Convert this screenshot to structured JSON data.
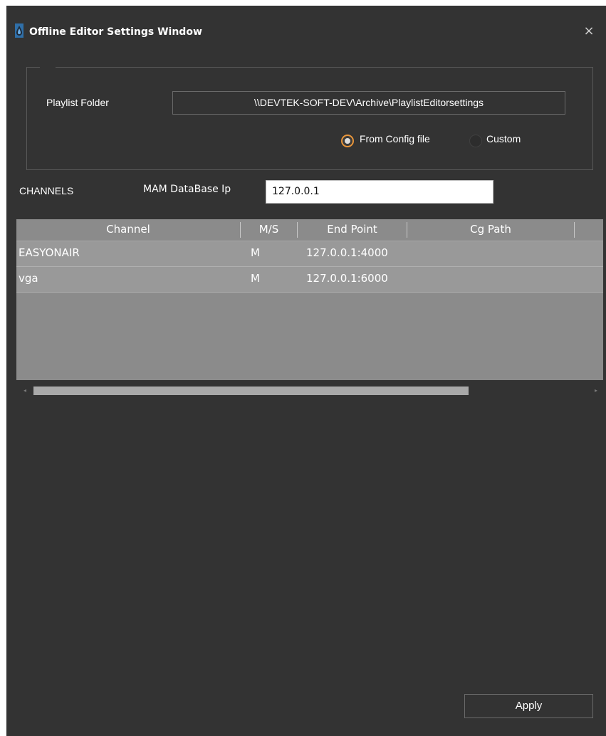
{
  "window": {
    "title": "Offline Editor Settings Window",
    "close_glyph": "×",
    "icon": "app-droplet-icon",
    "accent_color": "#e8953a",
    "background_color": "#333333"
  },
  "playlist": {
    "label": "Playlist Folder",
    "folder_value": "\\\\DEVTEK-SOFT-DEV\\Archive\\PlaylistEditorsettings",
    "radio_from_config": {
      "label": "From Config file",
      "checked": true
    },
    "radio_custom": {
      "label": "Custom",
      "checked": false
    }
  },
  "channels": {
    "label": "CHANNELS",
    "mam_label": "MAM DataBase Ip",
    "mam_value": "127.0.0.1"
  },
  "grid": {
    "columns": [
      "Channel",
      "M/S",
      "End Point",
      "Cg Path"
    ],
    "rows": [
      {
        "channel": "EASYONAIR",
        "ms": "M",
        "endpoint": "127.0.0.1:4000",
        "cgpath": ""
      },
      {
        "channel": "vga",
        "ms": "M",
        "endpoint": "127.0.0.1:6000",
        "cgpath": ""
      }
    ],
    "scroll_left_glyph": "◂",
    "scroll_right_glyph": "▸"
  },
  "footer": {
    "apply_label": "Apply"
  }
}
